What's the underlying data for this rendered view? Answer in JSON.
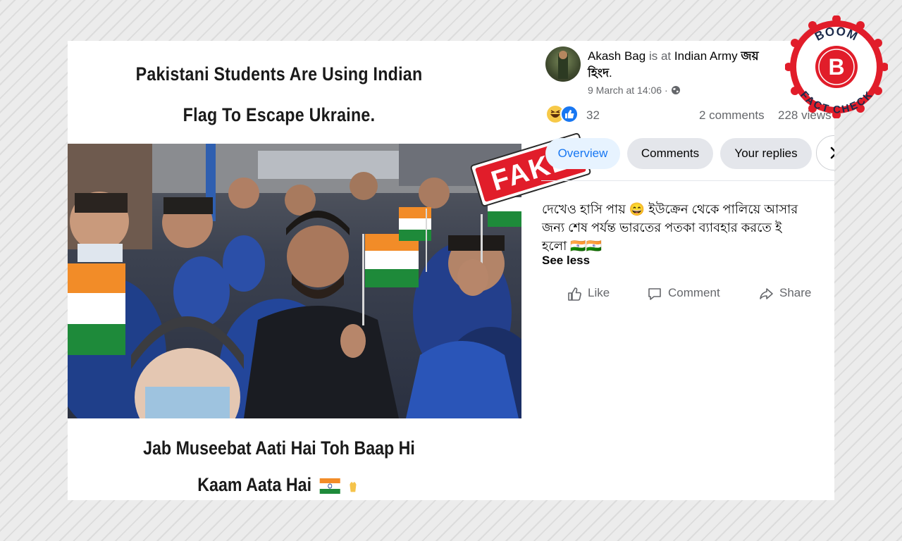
{
  "post_image": {
    "caption_top_line1": "Pakistani Students Are Using Indian",
    "caption_top_line2": "Flag To Escape Ukraine.",
    "caption_bottom_line1": "Jab Museebat Aati Hai Toh Baap Hi",
    "caption_bottom_line2": "Kaam Aata Hai",
    "stamp_label": "FAKE",
    "stamp_color": "#e11d2a"
  },
  "post": {
    "author": "Akash Bag",
    "is_at": "is at",
    "location": "Indian Army",
    "location_suffix_line1": "জয়",
    "location_suffix_line2": "হিংদ",
    "timestamp": "9 March at 14:06 ·",
    "reaction_count": "32",
    "comments": "2 comments",
    "views": "228 views",
    "text_line1": "দেখেও হাসি পায় 😄 ইউক্রেন থেকে পালিয়ে আসার",
    "text_line2": "জন্য শেষ পর্যন্ত ভারতের পতকা ব্যাবহার করতে ই",
    "text_line3": "হলো 🇮🇳🇮🇳",
    "see_less": "See less"
  },
  "tabs": [
    {
      "label": "Overview"
    },
    {
      "label": "Comments"
    },
    {
      "label": "Your replies"
    }
  ],
  "actions": {
    "like": "Like",
    "comment": "Comment",
    "share": "Share"
  },
  "badge": {
    "top": "BOOM",
    "bottom": "FACT CHECK",
    "letter": "B",
    "color": "#e11d2a"
  },
  "icons": [
    "globe-icon",
    "haha-reaction-icon",
    "like-reaction-icon",
    "chevron-right-icon",
    "like-icon",
    "comment-icon",
    "share-icon"
  ]
}
